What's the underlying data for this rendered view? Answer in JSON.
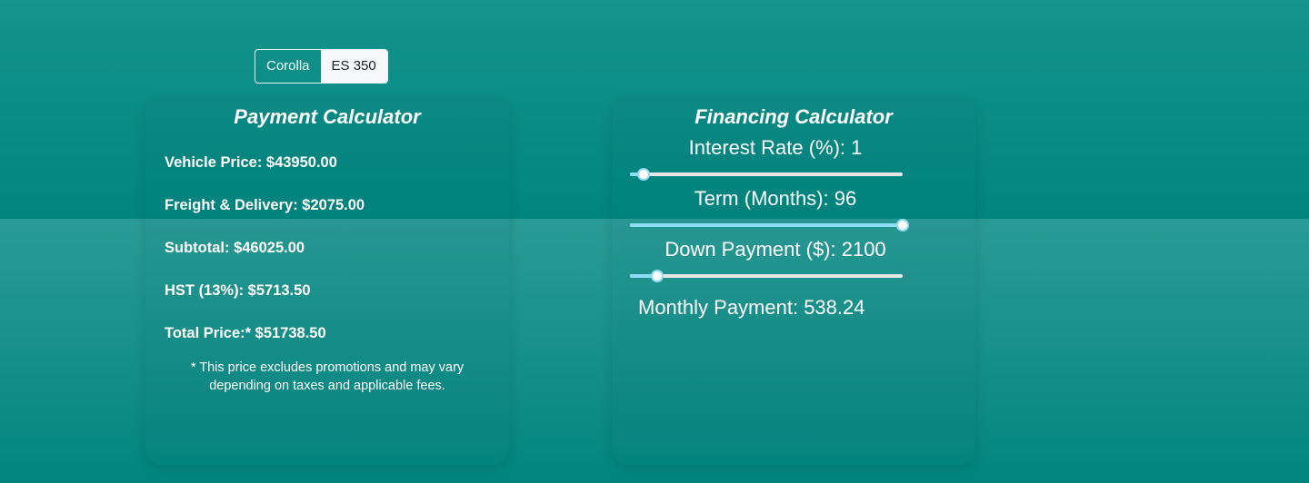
{
  "model_toggle": {
    "options": [
      "Corolla",
      "ES 350"
    ],
    "selected": "Corolla"
  },
  "payment": {
    "title": "Payment Calculator",
    "rows": [
      "Vehicle Price: $43950.00",
      "Freight & Delivery: $2075.00",
      "Subtotal: $46025.00",
      "HST (13%): $5713.50",
      "Total Price:* $51738.50"
    ],
    "note": "* This price excludes promotions and may vary depending on taxes and applicable fees."
  },
  "financing": {
    "title": "Financing Calculator",
    "sliders": [
      {
        "label": "Interest Rate (%): 1",
        "fraction": 0.05
      },
      {
        "label": "Term (Months): 96",
        "fraction": 1.0
      },
      {
        "label": "Down Payment ($): 2100",
        "fraction": 0.1
      }
    ],
    "monthly": "Monthly Payment: 538.24"
  },
  "colors": {
    "slider_accent": "#8fdcf5",
    "background": "#02857f"
  }
}
